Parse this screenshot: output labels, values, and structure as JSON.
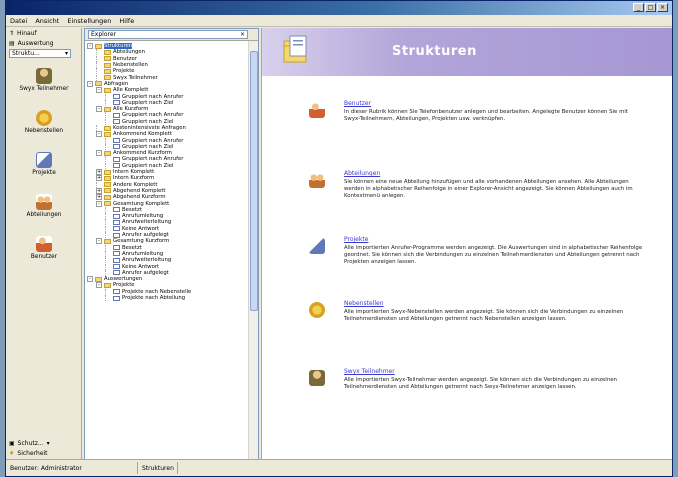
{
  "menubar": {
    "items": [
      "Datei",
      "Ansicht",
      "Einstellungen",
      "Hilfe"
    ]
  },
  "leftbar": {
    "top_rows": [
      {
        "label": "Hinauf",
        "icon": "up-arrow-icon"
      },
      {
        "label": "Auswertung",
        "icon": "chart-icon"
      }
    ],
    "dropdown": "Struktu...",
    "nav_items": [
      {
        "label": "Swyx Teilnehmer",
        "icon": "person-icon",
        "color": "#7a6a3a"
      },
      {
        "label": "Nebenstellen",
        "icon": "gear-cluster-icon",
        "color": "#d8a020"
      },
      {
        "label": "Projekte",
        "icon": "document-icon",
        "color": "#6078b8"
      },
      {
        "label": "Abteilungen",
        "icon": "group-icon",
        "color": "#c07030"
      },
      {
        "label": "Benutzer",
        "icon": "users-icon",
        "color": "#d06030"
      }
    ],
    "bottom_rows": [
      {
        "label": "Schutz...",
        "icon": "shield-icon"
      },
      {
        "label": "Sicherheit",
        "icon": "key-icon"
      }
    ]
  },
  "tree": {
    "combo": "Explorer",
    "nodes": [
      {
        "label": "Strukturen",
        "level": 1,
        "exp": "-",
        "selected": true
      },
      {
        "label": "Abteilungen",
        "level": 2,
        "exp": ""
      },
      {
        "label": "Benutzer",
        "level": 2,
        "exp": ""
      },
      {
        "label": "Nebenstellen",
        "level": 2,
        "exp": ""
      },
      {
        "label": "Projekte",
        "level": 2,
        "exp": ""
      },
      {
        "label": "Swyx Teilnehmer",
        "level": 2,
        "exp": ""
      },
      {
        "label": "Abfragen",
        "level": 1,
        "exp": "-"
      },
      {
        "label": "Alle Komplett",
        "level": 2,
        "exp": "-"
      },
      {
        "label": "Gruppiert nach Anrufer",
        "level": 3,
        "exp": ""
      },
      {
        "label": "Gruppiert nach Ziel",
        "level": 3,
        "exp": ""
      },
      {
        "label": "Alle Kurzform",
        "level": 2,
        "exp": "-"
      },
      {
        "label": "Gruppiert nach Anrufer",
        "level": 3,
        "exp": ""
      },
      {
        "label": "Gruppiert nach Ziel",
        "level": 3,
        "exp": ""
      },
      {
        "label": "Kostenintensivste Anfragen",
        "level": 2,
        "exp": ""
      },
      {
        "label": "Ankommend Komplett",
        "level": 2,
        "exp": "-"
      },
      {
        "label": "Gruppiert nach Anrufer",
        "level": 3,
        "exp": ""
      },
      {
        "label": "Gruppiert nach Ziel",
        "level": 3,
        "exp": ""
      },
      {
        "label": "Ankommend Kurzform",
        "level": 2,
        "exp": "-"
      },
      {
        "label": "Gruppiert nach Anrufer",
        "level": 3,
        "exp": ""
      },
      {
        "label": "Gruppiert nach Ziel",
        "level": 3,
        "exp": ""
      },
      {
        "label": "Intern Komplett",
        "level": 2,
        "exp": "+"
      },
      {
        "label": "Intern Kurzform",
        "level": 2,
        "exp": "+"
      },
      {
        "label": "Andere Komplett",
        "level": 2,
        "exp": ""
      },
      {
        "label": "Abgehend Komplett",
        "level": 2,
        "exp": "+"
      },
      {
        "label": "Abgehend Kurzform",
        "level": 2,
        "exp": "+"
      },
      {
        "label": "Gesamtung Komplett",
        "level": 2,
        "exp": "-"
      },
      {
        "label": "Besetzt",
        "level": 3,
        "exp": ""
      },
      {
        "label": "Anrufumleitung",
        "level": 3,
        "exp": ""
      },
      {
        "label": "Anrufweiterleitung",
        "level": 3,
        "exp": ""
      },
      {
        "label": "Keine Antwort",
        "level": 3,
        "exp": ""
      },
      {
        "label": "Anrufer aufgelegt",
        "level": 3,
        "exp": ""
      },
      {
        "label": "Gesamtung Kurzform",
        "level": 2,
        "exp": "-"
      },
      {
        "label": "Besetzt",
        "level": 3,
        "exp": ""
      },
      {
        "label": "Anrufumleitung",
        "level": 3,
        "exp": ""
      },
      {
        "label": "Anrufweiterleitung",
        "level": 3,
        "exp": ""
      },
      {
        "label": "Keine Antwort",
        "level": 3,
        "exp": ""
      },
      {
        "label": "Anrufer aufgelegt",
        "level": 3,
        "exp": ""
      },
      {
        "label": "Auswertungen",
        "level": 1,
        "exp": "-"
      },
      {
        "label": "Projekte",
        "level": 2,
        "exp": "-"
      },
      {
        "label": "Projekte nach Nebenstelle",
        "level": 3,
        "exp": ""
      },
      {
        "label": "Projekte nach Abteilung",
        "level": 3,
        "exp": ""
      }
    ]
  },
  "content": {
    "title": "Strukturen",
    "sections": [
      {
        "link": "Benutzer",
        "icon": "users-icon",
        "color": "#d06030",
        "desc": "In dieser Rubrik können Sie Telefonbenutzer anlegen und bearbeiten. Angelegte Benutzer können Sie mit Swyx-Teilnehmern, Abteilungen, Projekten usw. verknüpfen."
      },
      {
        "link": "Abteilungen",
        "icon": "group-icon",
        "color": "#c07030",
        "desc": "Sie können eine neue Abteilung hinzufügen und alle vorhandenen Abteilungen ansehen. Alle Abteilungen werden in alphabetischer Reihenfolge in einer Explorer-Ansicht angezeigt. Sie können Abteilungen auch im Kontextmenü anlegen."
      },
      {
        "link": "Projekte",
        "icon": "document-icon",
        "color": "#6078b8",
        "desc": "Alle importierten Anrufer-Programme werden angezeigt. Die Auswertungen sind in alphabetischer Reihenfolge geordnet. Sie können sich die Verbindungen zu einzelnen Teilnehmerdiensten und Abteilungen getrennt nach Projekten anzeigen lassen."
      },
      {
        "link": "Nebenstellen",
        "icon": "gear-cluster-icon",
        "color": "#d8a020",
        "desc": "Alle importierten Swyx-Nebenstellen werden angezeigt. Sie können sich die Verbindungen zu einzelnen Teilnehmerdiensten und Abteilungen getrennt nach Nebenstellen anzeigen lassen."
      },
      {
        "link": "Swyx Teilnehmer",
        "icon": "person-icon",
        "color": "#7a6a3a",
        "desc": "Alle importierten Swyx-Teilnehmer werden angezeigt. Sie können sich die Verbindungen zu einzelnen Teilnehmerdiensten und Abteilungen getrennt nach Swyx-Teilnehmer anzeigen lassen."
      }
    ]
  },
  "statusbar": {
    "left": "Benutzer: Administrator",
    "right": "Strukturen"
  }
}
